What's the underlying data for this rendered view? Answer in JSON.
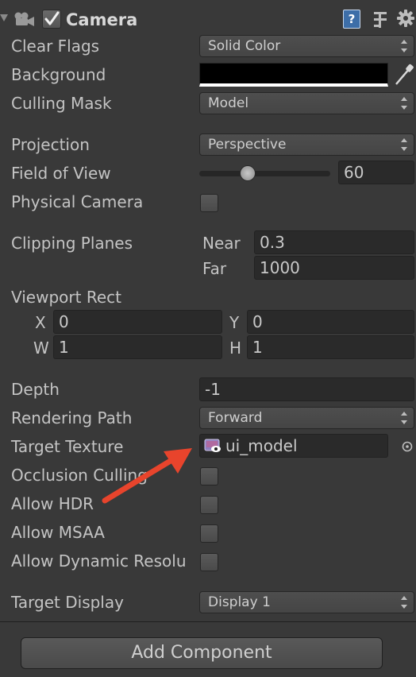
{
  "header": {
    "title": "Camera",
    "enabled": true
  },
  "labels": {
    "clear_flags": "Clear Flags",
    "background": "Background",
    "culling_mask": "Culling Mask",
    "projection": "Projection",
    "fov": "Field of View",
    "physical_camera": "Physical Camera",
    "clipping_planes": "Clipping Planes",
    "near": "Near",
    "far": "Far",
    "viewport_rect": "Viewport Rect",
    "x": "X",
    "y": "Y",
    "w": "W",
    "h": "H",
    "depth": "Depth",
    "rendering_path": "Rendering Path",
    "target_texture": "Target Texture",
    "occlusion_culling": "Occlusion Culling",
    "allow_hdr": "Allow HDR",
    "allow_msaa": "Allow MSAA",
    "allow_dynamic_resolution": "Allow Dynamic Resolu",
    "target_display": "Target Display"
  },
  "values": {
    "clear_flags": "Solid Color",
    "background_color": "#000000",
    "culling_mask": "Model",
    "projection": "Perspective",
    "fov": "60",
    "fov_slider_fraction": 0.35,
    "near": "0.3",
    "far": "1000",
    "x": "0",
    "y": "0",
    "w": "1",
    "h": "1",
    "depth": "-1",
    "rendering_path": "Forward",
    "target_texture": "ui_model",
    "target_display": "Display 1",
    "physical_camera": false,
    "occlusion_culling": false,
    "allow_hdr": false,
    "allow_msaa": false,
    "allow_dynamic_resolution": false
  },
  "footer": {
    "add_component": "Add Component"
  },
  "icons": {
    "camera": "camera-icon",
    "help": "help-icon",
    "preset": "preset-icon",
    "settings": "gear-icon",
    "eyedropper": "eyedropper-icon",
    "object_picker": "object-picker-icon",
    "texture": "render-texture-icon"
  },
  "colors": {
    "panel": "#393939",
    "arrow_annotation": "#e8442c"
  }
}
